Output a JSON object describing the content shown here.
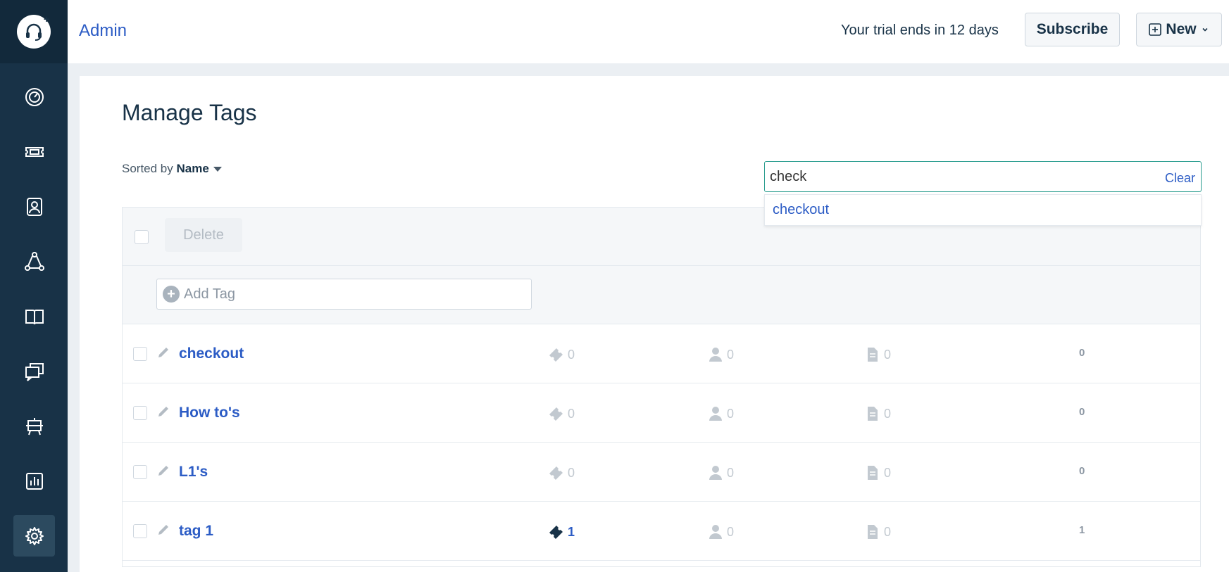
{
  "header": {
    "title": "Admin",
    "trial_text": "Your trial ends in 12 days",
    "subscribe_label": "Subscribe",
    "new_label": "New"
  },
  "sidebar": {
    "items": [
      {
        "name": "dashboard",
        "icon": "speedometer-icon"
      },
      {
        "name": "tickets",
        "icon": "ticket-icon"
      },
      {
        "name": "contacts",
        "icon": "contact-card-icon"
      },
      {
        "name": "groups",
        "icon": "network-icon"
      },
      {
        "name": "solutions",
        "icon": "book-icon"
      },
      {
        "name": "forums",
        "icon": "chat-bubbles-icon"
      },
      {
        "name": "social",
        "icon": "robot-icon"
      },
      {
        "name": "reports",
        "icon": "bar-chart-icon"
      },
      {
        "name": "admin",
        "icon": "gear-icon",
        "active": true
      }
    ]
  },
  "page": {
    "title": "Manage Tags",
    "sorted_prefix": "Sorted by",
    "sorted_field": "Name",
    "delete_label": "Delete",
    "add_tag_placeholder": "Add Tag"
  },
  "search": {
    "value": "check",
    "clear_label": "Clear",
    "suggestions": [
      "checkout"
    ]
  },
  "tags": [
    {
      "name": "checkout",
      "tickets": "0",
      "contacts": "0",
      "articles": "0",
      "total": "0"
    },
    {
      "name": "How to's",
      "tickets": "0",
      "contacts": "0",
      "articles": "0",
      "total": "0"
    },
    {
      "name": "L1's",
      "tickets": "0",
      "contacts": "0",
      "articles": "0",
      "total": "0"
    },
    {
      "name": "tag 1",
      "tickets": "1",
      "contacts": "0",
      "articles": "0",
      "total": "1"
    }
  ],
  "colors": {
    "sidebar": "#183247",
    "link": "#2c5cc5",
    "search_border": "#2a9d8f"
  }
}
